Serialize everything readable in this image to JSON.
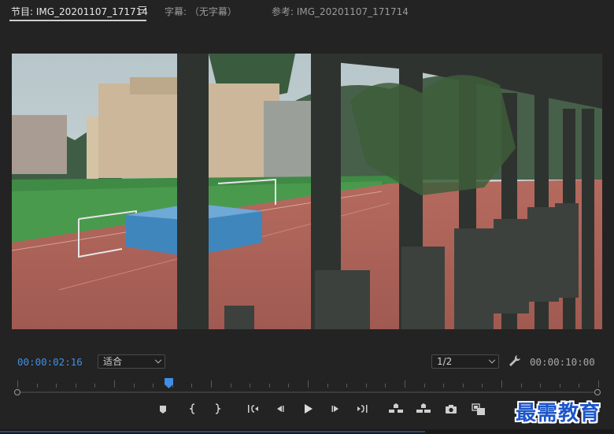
{
  "tabs": [
    {
      "label": "节目: IMG_20201107_171714",
      "active": true
    },
    {
      "label": "字幕: （无字幕）",
      "active": false
    },
    {
      "label": "参考: IMG_20201107_171714",
      "active": false
    }
  ],
  "tab_menu_icon": "hamburger-menu-icon",
  "viewer": {
    "content": "video-frame"
  },
  "playback": {
    "current_timecode": "00:00:02:16",
    "fit_select": "适合",
    "resolution_select": "1/2",
    "duration_timecode": "00:00:10:00"
  },
  "scrubber": {
    "playhead_fraction": 0.26
  },
  "controls": [
    {
      "name": "add-marker-button",
      "icon": "marker-icon"
    },
    {
      "name": "mark-in-button",
      "icon": "mark-in-icon"
    },
    {
      "name": "mark-out-button",
      "icon": "mark-out-icon"
    },
    {
      "name": "go-to-in-button",
      "icon": "go-to-in-icon"
    },
    {
      "name": "step-back-button",
      "icon": "step-back-icon"
    },
    {
      "name": "play-button",
      "icon": "play-icon"
    },
    {
      "name": "step-forward-button",
      "icon": "step-forward-icon"
    },
    {
      "name": "go-to-out-button",
      "icon": "go-to-out-icon"
    },
    {
      "name": "lift-button",
      "icon": "lift-icon"
    },
    {
      "name": "extract-button",
      "icon": "extract-icon"
    },
    {
      "name": "export-frame-button",
      "icon": "camera-icon"
    },
    {
      "name": "comparison-view-button",
      "icon": "comparison-icon"
    }
  ],
  "watermark": "最需教育",
  "colors": {
    "accent": "#3f8fe6",
    "background": "#232323",
    "watermark": "#1d55c9"
  }
}
